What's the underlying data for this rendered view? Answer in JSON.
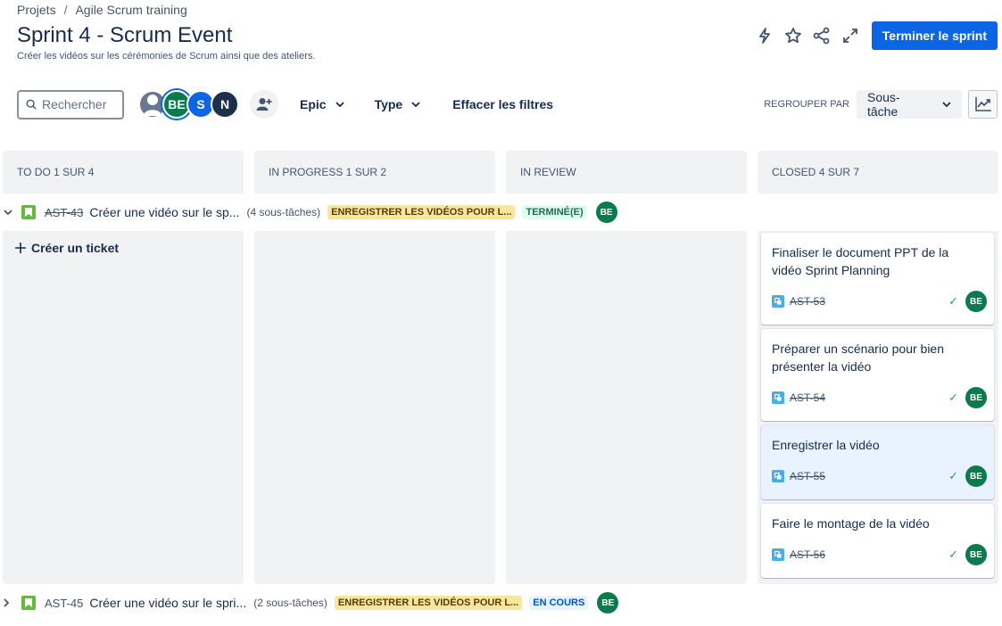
{
  "breadcrumb": {
    "projects": "Projets",
    "separator": "/",
    "project": "Agile Scrum training"
  },
  "page": {
    "title": "Sprint 4 - Scrum Event",
    "subtitle": "Créer les vidéos sur les cérémonies de Scrum ainsi que des ateliers.",
    "complete_sprint": "Terminer le sprint"
  },
  "toolbar": {
    "search_placeholder": "Rechercher",
    "avatars": [
      {
        "initials": "",
        "color": "#6b778c"
      },
      {
        "initials": "BE",
        "color": "#0b7a4c"
      },
      {
        "initials": "S",
        "color": "#0c66e4"
      },
      {
        "initials": "N",
        "color": "#1d2f4a"
      }
    ],
    "epic": "Epic",
    "type": "Type",
    "clear_filters": "Effacer les filtres",
    "group_by_label": "REGROUPER PAR",
    "group_by_value": "Sous-tâche"
  },
  "columns": [
    {
      "name": "TO DO",
      "count": "1 SUR 4"
    },
    {
      "name": "IN PROGRESS",
      "count": "1 SUR 2"
    },
    {
      "name": "IN REVIEW",
      "count": ""
    },
    {
      "name": "CLOSED",
      "count": "4 SUR 7"
    }
  ],
  "swimlanes": [
    {
      "key": "AST-43",
      "summary": "Créer une vidéo sur le sp...",
      "subtasks": "(4 sous-tâches)",
      "epic": "ENREGISTRER LES VIDÉOS POUR L...",
      "status": "TERMINÉ(E)",
      "assignee": "BE"
    },
    {
      "key": "AST-45",
      "summary": "Créer une vidéo sur le spri...",
      "subtasks": "(2 sous-tâches)",
      "epic": "ENREGISTRER LES VIDÉOS POUR L...",
      "status": "EN COURS",
      "assignee": "BE"
    }
  ],
  "create_ticket": "Créer un ticket",
  "closed_cards": [
    {
      "title": "Finaliser le document PPT de la vidéo Sprint Planning",
      "key": "AST-53",
      "assignee": "BE"
    },
    {
      "title": "Préparer un scénario pour bien présenter la vidéo",
      "key": "AST-54",
      "assignee": "BE"
    },
    {
      "title": "Enregistrer la vidéo",
      "key": "AST-55",
      "assignee": "BE"
    },
    {
      "title": "Faire le montage de la vidéo",
      "key": "AST-56",
      "assignee": "BE"
    }
  ]
}
